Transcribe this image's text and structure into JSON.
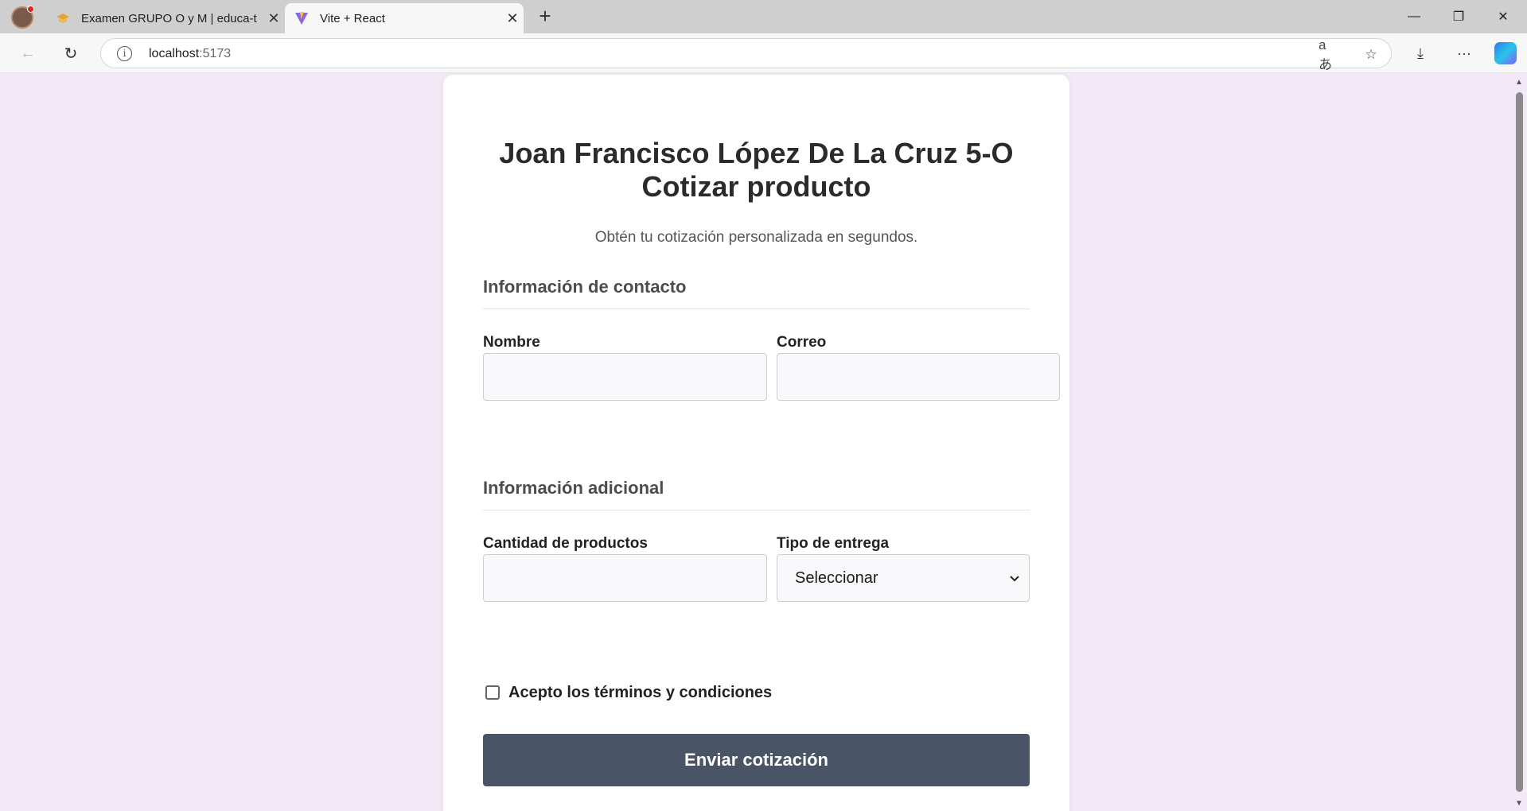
{
  "browser": {
    "tabs": [
      {
        "title": "Examen GRUPO O y M | educa-t",
        "favicon": "educa-favicon-icon"
      },
      {
        "title": "Vite + React",
        "favicon": "vite-favicon-icon"
      }
    ],
    "url_host": "localhost",
    "url_port": ":5173"
  },
  "page": {
    "heading_line1": "Joan Francisco López De La Cruz 5-O",
    "heading_line2": "Cotizar producto",
    "subtitle": "Obtén tu cotización personalizada en segundos.",
    "contact_section": {
      "title": "Información de contacto",
      "name_label": "Nombre",
      "email_label": "Correo",
      "name_value": "",
      "email_value": ""
    },
    "additional_section": {
      "title": "Información adicional",
      "quantity_label": "Cantidad de productos",
      "quantity_value": "",
      "delivery_label": "Tipo de entrega",
      "delivery_selected": "Seleccionar"
    },
    "terms_label": "Acepto los términos y condiciones",
    "terms_checked": false,
    "submit_label": "Enviar cotización"
  },
  "colors": {
    "page_background": "#f3e8f6",
    "card_background": "#ffffff",
    "submit_button": "#495566"
  }
}
